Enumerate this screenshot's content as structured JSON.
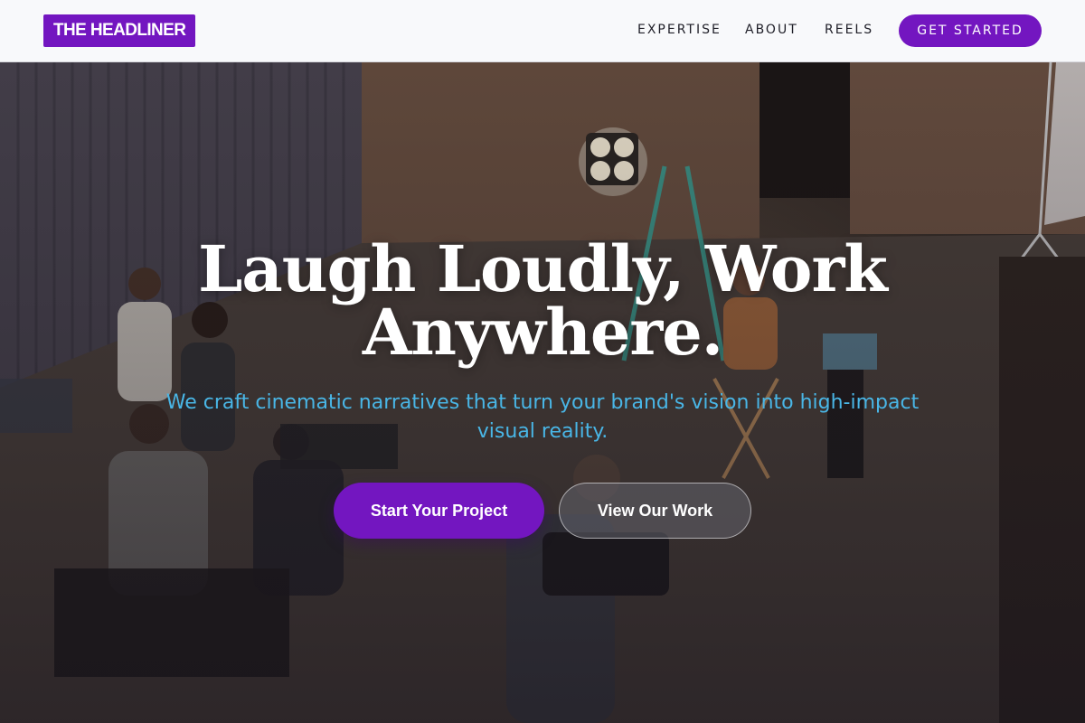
{
  "header": {
    "logo_text": "THE HEADLINER",
    "nav": [
      {
        "label": "EXPERTISE"
      },
      {
        "label": "ABOUT"
      },
      {
        "label": "REELS"
      }
    ],
    "cta_label": "GET STARTED"
  },
  "hero": {
    "title_line1": "Laugh Loudly, Work",
    "title_line2": "Anywhere.",
    "subtitle": "We craft cinematic narratives that turn your brand's vision into high-impact visual reality.",
    "primary_button": "Start Your Project",
    "secondary_button": "View Our Work",
    "background": "film crew on set in warehouse studio"
  },
  "colors": {
    "brand_purple": "#7316c0",
    "nav_background": "#f8f9fb",
    "subtitle_blue": "#49b6e6",
    "title_white": "#ffffff"
  }
}
